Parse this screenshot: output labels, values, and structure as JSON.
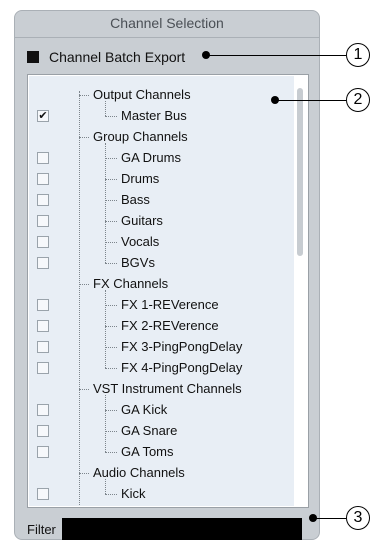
{
  "panel": {
    "title": "Channel Selection"
  },
  "batch_export": {
    "label": "Channel Batch Export",
    "checked": true
  },
  "tree": [
    {
      "label": "Output Channels",
      "group": true,
      "checkbox": false
    },
    {
      "label": "Master Bus",
      "group": false,
      "checkbox": true,
      "checked": true,
      "last": true
    },
    {
      "label": "Group Channels",
      "group": true,
      "checkbox": false
    },
    {
      "label": "GA Drums",
      "group": false,
      "checkbox": true,
      "checked": false
    },
    {
      "label": "Drums",
      "group": false,
      "checkbox": true,
      "checked": false
    },
    {
      "label": "Bass",
      "group": false,
      "checkbox": true,
      "checked": false
    },
    {
      "label": "Guitars",
      "group": false,
      "checkbox": true,
      "checked": false
    },
    {
      "label": "Vocals",
      "group": false,
      "checkbox": true,
      "checked": false
    },
    {
      "label": "BGVs",
      "group": false,
      "checkbox": true,
      "checked": false,
      "last": true
    },
    {
      "label": "FX Channels",
      "group": true,
      "checkbox": false
    },
    {
      "label": "FX 1-REVerence",
      "group": false,
      "checkbox": true,
      "checked": false
    },
    {
      "label": "FX 2-REVerence",
      "group": false,
      "checkbox": true,
      "checked": false
    },
    {
      "label": "FX 3-PingPongDelay",
      "group": false,
      "checkbox": true,
      "checked": false
    },
    {
      "label": "FX 4-PingPongDelay",
      "group": false,
      "checkbox": true,
      "checked": false,
      "last": true
    },
    {
      "label": "VST Instrument Channels",
      "group": true,
      "checkbox": false
    },
    {
      "label": "GA Kick",
      "group": false,
      "checkbox": true,
      "checked": false
    },
    {
      "label": "GA Snare",
      "group": false,
      "checkbox": true,
      "checked": false
    },
    {
      "label": "GA Toms",
      "group": false,
      "checkbox": true,
      "checked": false,
      "last": true
    },
    {
      "label": "Audio Channels",
      "group": true,
      "checkbox": false
    },
    {
      "label": "Kick",
      "group": false,
      "checkbox": true,
      "checked": false
    }
  ],
  "filter": {
    "label": "Filter",
    "value": ""
  },
  "callouts": [
    "1",
    "2",
    "3"
  ]
}
